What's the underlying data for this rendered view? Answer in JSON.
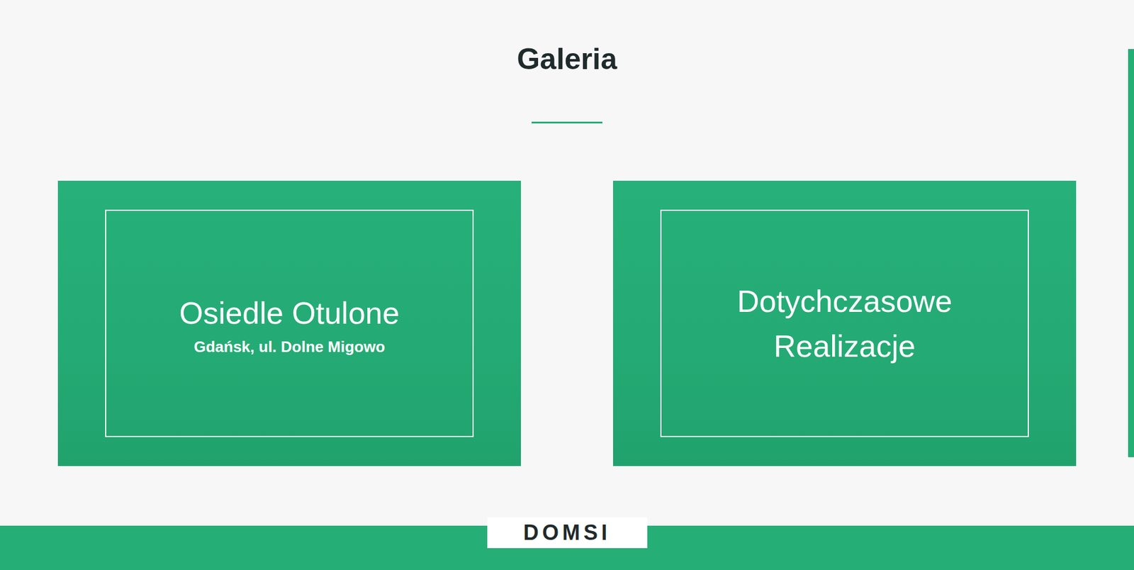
{
  "title": "Galeria",
  "cards": [
    {
      "title": "Osiedle Otulone",
      "subtitle": "Gdańsk, ul. Dolne Migowo"
    },
    {
      "title": "Dotychczasowe Realizacje"
    }
  ],
  "logo": "DOMSI"
}
